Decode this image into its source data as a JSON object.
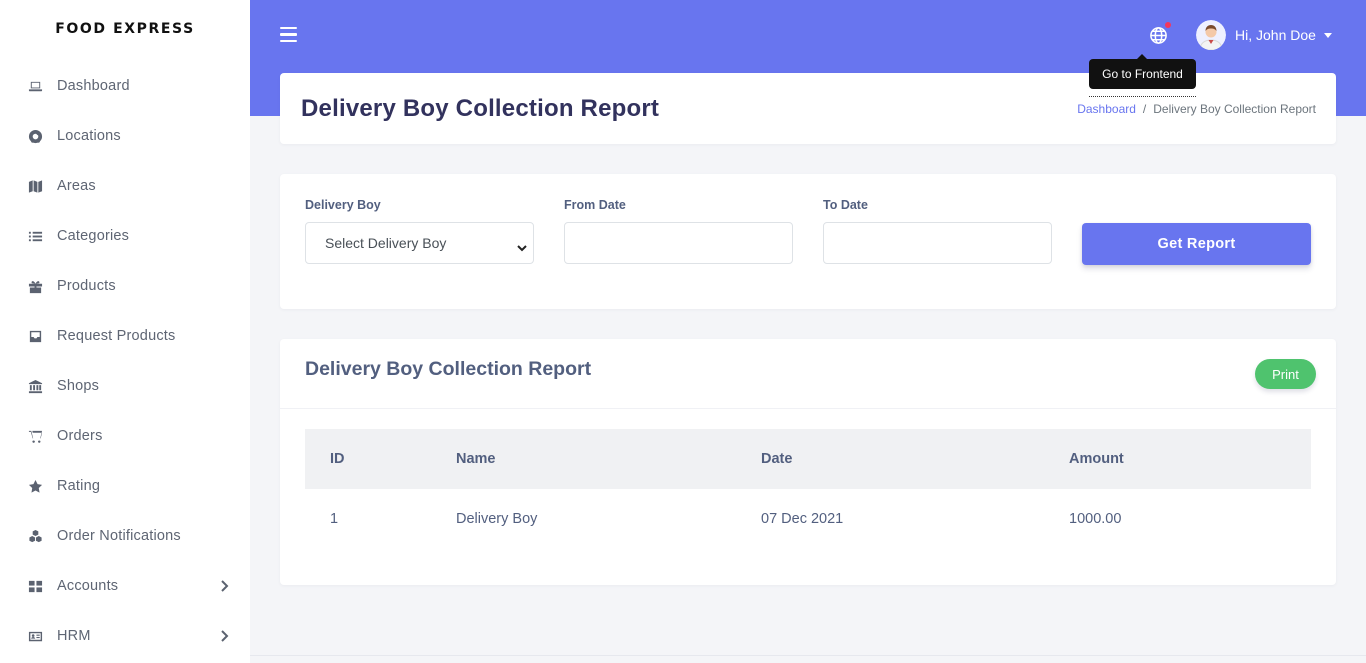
{
  "sidebar": {
    "brand": "FOOD EXPRESS",
    "items": [
      {
        "label": "Dashboard",
        "icon": "laptop-icon"
      },
      {
        "label": "Locations",
        "icon": "life-ring-icon"
      },
      {
        "label": "Areas",
        "icon": "map-icon"
      },
      {
        "label": "Categories",
        "icon": "list-icon"
      },
      {
        "label": "Products",
        "icon": "gift-icon"
      },
      {
        "label": "Request Products",
        "icon": "inbox-icon"
      },
      {
        "label": "Shops",
        "icon": "bank-icon"
      },
      {
        "label": "Orders",
        "icon": "cart-icon"
      },
      {
        "label": "Rating",
        "icon": "star-icon"
      },
      {
        "label": "Order Notifications",
        "icon": "cubes-icon"
      },
      {
        "label": "Accounts",
        "icon": "grid-icon",
        "has_submenu": true
      },
      {
        "label": "HRM",
        "icon": "id-card-icon",
        "has_submenu": true
      }
    ]
  },
  "header": {
    "user_greeting": "Hi, John Doe",
    "tooltip": "Go to Frontend",
    "accent_color": "#6875ef"
  },
  "page": {
    "title": "Delivery Boy Collection Report",
    "breadcrumb": {
      "home": "Dashboard",
      "separator": "/",
      "current": "Delivery Boy Collection Report"
    }
  },
  "filters": {
    "delivery_boy_label": "Delivery Boy",
    "delivery_boy_selected": "Select Delivery Boy",
    "from_date_label": "From Date",
    "from_date_value": "",
    "to_date_label": "To Date",
    "to_date_value": "",
    "submit_label": "Get Report"
  },
  "report": {
    "title": "Delivery Boy Collection Report",
    "print_label": "Print",
    "columns": [
      "ID",
      "Name",
      "Date",
      "Amount"
    ],
    "rows": [
      {
        "id": "1",
        "name": "Delivery Boy",
        "date": "07 Dec 2021",
        "amount": "1000.00"
      }
    ]
  }
}
